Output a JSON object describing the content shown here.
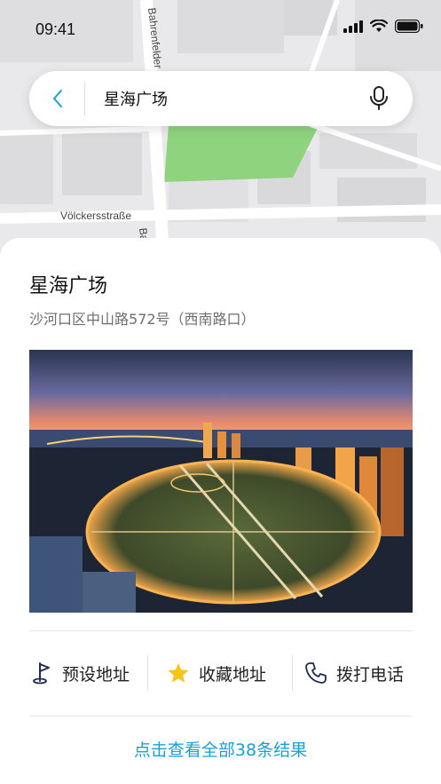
{
  "status_bar": {
    "time": "09:41"
  },
  "map": {
    "street_labels": [
      "Bahrenfelder",
      "Völckersstraße",
      "Ba"
    ]
  },
  "search": {
    "query": "星海广场"
  },
  "place": {
    "title": "星海广场",
    "address": "沙河口区中山路572号（西南路口）"
  },
  "actions": [
    {
      "label": "预设地址",
      "icon": "flag-icon"
    },
    {
      "label": "收藏地址",
      "icon": "star-icon"
    },
    {
      "label": "拨打电话",
      "icon": "phone-icon"
    }
  ],
  "more_results": "点击查看全部38条结果",
  "colors": {
    "accent": "#1aa0d6",
    "star": "#f5c518",
    "park": "#8fd37f"
  }
}
